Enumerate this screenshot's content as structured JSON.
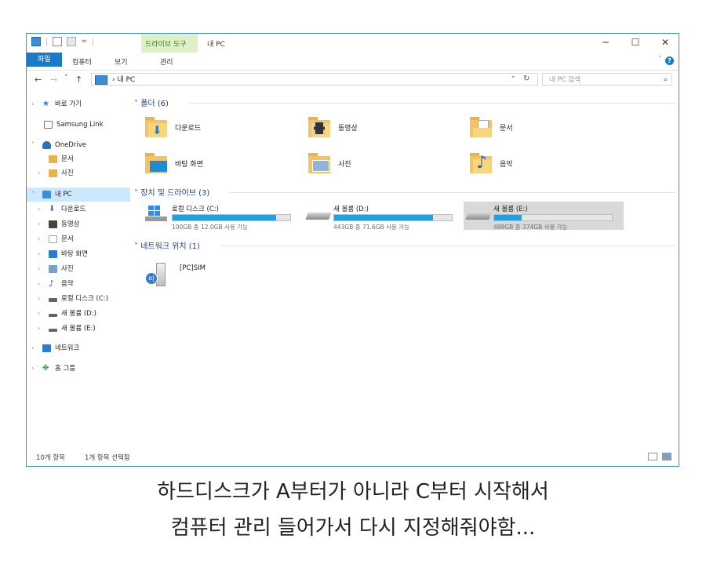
{
  "window": {
    "contextual_tab_group": "드라이브 도구",
    "title": "내 PC",
    "minimize": "─",
    "maximize": "☐",
    "close": "✕"
  },
  "ribbon": {
    "tabs": [
      "파일",
      "컴퓨터",
      "보기",
      "관리"
    ],
    "collapse": "˅",
    "help": "?"
  },
  "address": {
    "back": "←",
    "forward": "→",
    "recent": "˅",
    "up": "↑",
    "path_sep": "›",
    "path": "내 PC",
    "dropdown": "˅",
    "refresh": "↻",
    "search_placeholder": "내 PC 검색",
    "search_icon": "⌕"
  },
  "nav": {
    "items": [
      {
        "label": "바로 가기",
        "icon": "star-icon",
        "color": "#2b7bd6"
      },
      {
        "label": "Samsung Link",
        "icon": "samsung-link-icon",
        "color": "#777777"
      },
      {
        "label": "OneDrive",
        "icon": "onedrive-icon",
        "color": "#2e6fbd"
      },
      {
        "label": "문서",
        "icon": "documents-icon",
        "color": "#e8b24c"
      },
      {
        "label": "사진",
        "icon": "pictures-icon",
        "color": "#e8b24c"
      },
      {
        "label": "내 PC",
        "icon": "pc-icon",
        "color": "#3a8fd8"
      },
      {
        "label": "다운로드",
        "icon": "download-icon",
        "color": "#2b7bd6"
      },
      {
        "label": "동영상",
        "icon": "videos-icon",
        "color": "#444444"
      },
      {
        "label": "문서",
        "icon": "documents-icon",
        "color": "#9aa4b0"
      },
      {
        "label": "바탕 화면",
        "icon": "desktop-icon",
        "color": "#2b7bd6"
      },
      {
        "label": "사진",
        "icon": "pictures-icon",
        "color": "#7aa0c4"
      },
      {
        "label": "음악",
        "icon": "music-icon",
        "color": "#1f6fbf"
      },
      {
        "label": "로컬 디스크 (C:)",
        "icon": "drive-c-icon",
        "color": "#666666"
      },
      {
        "label": "새 볼륨 (D:)",
        "icon": "drive-icon",
        "color": "#666666"
      },
      {
        "label": "새 볼륨 (E:)",
        "icon": "drive-icon",
        "color": "#666666"
      },
      {
        "label": "네트워크",
        "icon": "network-icon",
        "color": "#2b7bd6"
      },
      {
        "label": "홈 그룹",
        "icon": "homegroup-icon",
        "color": "#3c9d3c"
      }
    ]
  },
  "groups": {
    "folders": {
      "label": "폴더 (6)",
      "toggle": "˅"
    },
    "drives": {
      "label": "장치 및 드라이브 (3)",
      "toggle": "˅"
    },
    "network": {
      "label": "네트워크 위치 (1)",
      "toggle": "˅"
    }
  },
  "folders": [
    {
      "name": "다운로드",
      "icon": "download-folder-icon"
    },
    {
      "name": "동영상",
      "icon": "videos-folder-icon"
    },
    {
      "name": "문서",
      "icon": "documents-folder-icon"
    },
    {
      "name": "바탕 화면",
      "icon": "desktop-folder-icon"
    },
    {
      "name": "사진",
      "icon": "pictures-folder-icon"
    },
    {
      "name": "음악",
      "icon": "music-folder-icon"
    }
  ],
  "drives": [
    {
      "name": "로컬 디스크 (C:)",
      "info": "100GB 중 12.0GB 사용 가능",
      "used_fraction": 0.88
    },
    {
      "name": "새 볼륨 (D:)",
      "info": "443GB 중 71.6GB 사용 가능",
      "used_fraction": 0.84
    },
    {
      "name": "새 볼륨 (E:)",
      "info": "488GB 중 374GB 사용 가능",
      "used_fraction": 0.23
    }
  ],
  "network_locations": [
    {
      "name": "[PC]SIM",
      "icon": "network-pc-icon"
    }
  ],
  "status": {
    "count": "10개 항목",
    "selected": "1개 항목 선택함"
  },
  "caption": {
    "line1": "하드디스크가 A부터가 아니라 C부터 시작해서",
    "line2": "컴퓨터 관리 들어가서 다시 지정해줘야함..."
  }
}
